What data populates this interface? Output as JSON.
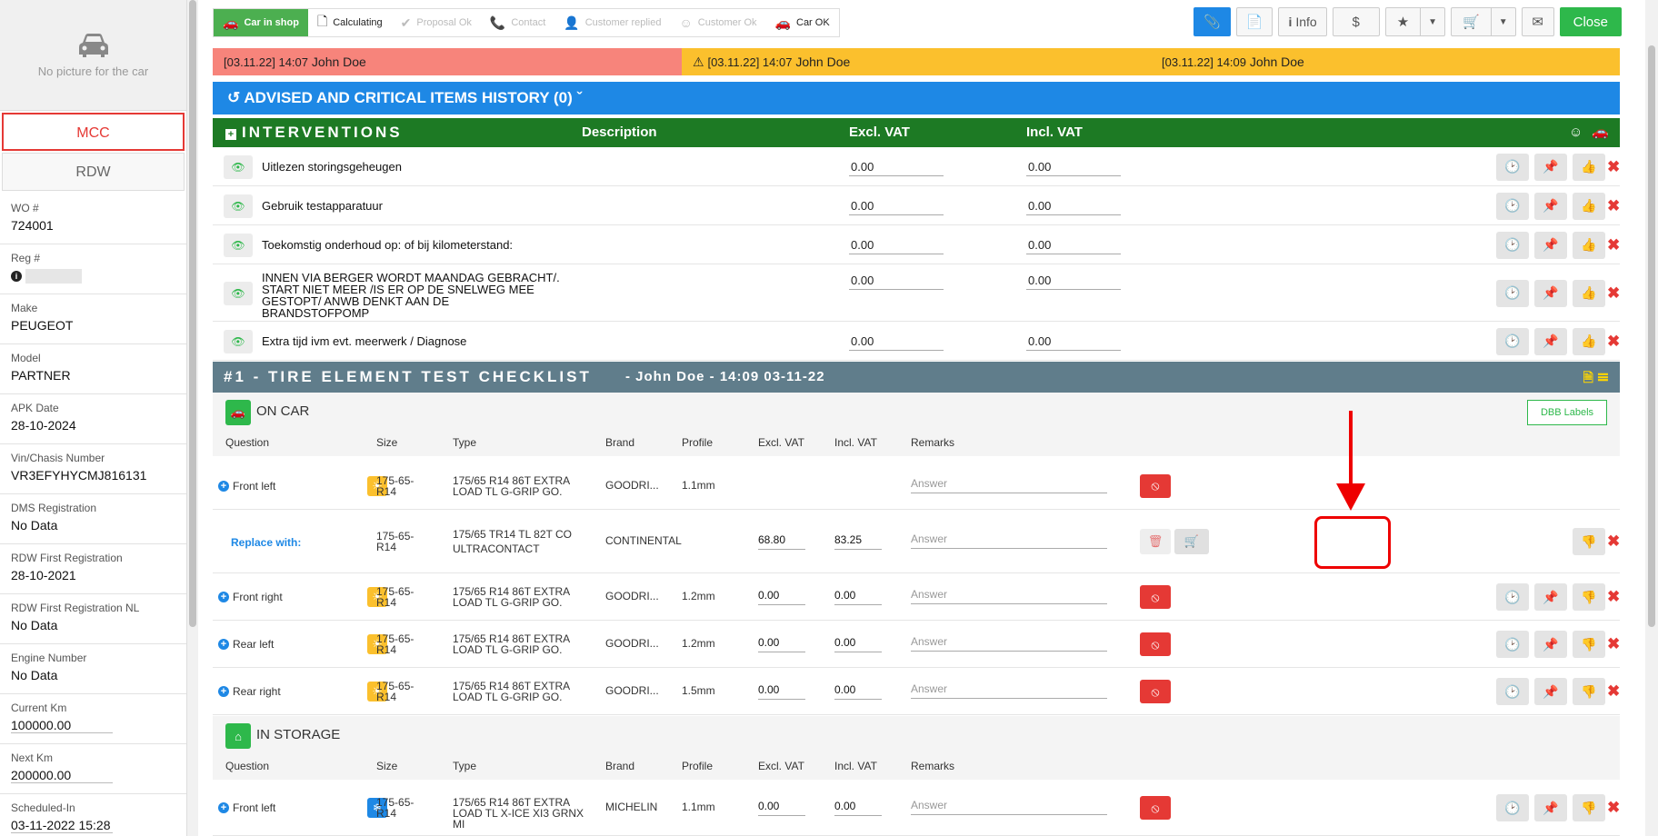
{
  "sidebar": {
    "no_picture": "No picture for the car",
    "mcc": "MCC",
    "rdw": "RDW",
    "fields": [
      {
        "label": "WO #",
        "value": "724001"
      },
      {
        "label": "Reg #",
        "value": ""
      },
      {
        "label": "Make",
        "value": "PEUGEOT"
      },
      {
        "label": "Model",
        "value": "PARTNER"
      },
      {
        "label": "APK Date",
        "value": "28-10-2024"
      },
      {
        "label": "Vin/Chasis Number",
        "value": "VR3EFYHYCMJ816131"
      },
      {
        "label": "DMS Registration",
        "value": "No Data"
      },
      {
        "label": "RDW First Registration",
        "value": "28-10-2021"
      },
      {
        "label": "RDW First Registration NL",
        "value": "No Data"
      },
      {
        "label": "Engine Number",
        "value": "No Data"
      },
      {
        "label": "Current Km",
        "value": "100000.00"
      },
      {
        "label": "Next Km",
        "value": "200000.00"
      },
      {
        "label": "Scheduled-In",
        "value": "03-11-2022 15:28"
      }
    ]
  },
  "steps": [
    {
      "label": "Car in shop",
      "icon": "car-icon"
    },
    {
      "label": "Calculating",
      "icon": "document-icon"
    },
    {
      "label": "Proposal Ok",
      "icon": "check-icon"
    },
    {
      "label": "Contact",
      "icon": "phone-icon"
    },
    {
      "label": "Customer replied",
      "icon": "user-check-icon"
    },
    {
      "label": "Customer Ok",
      "icon": "smile-icon"
    },
    {
      "label": "Car OK",
      "icon": "car-icon"
    }
  ],
  "toolbar": {
    "info": "Info",
    "dollar": "$",
    "close": "Close"
  },
  "notes": [
    {
      "date": "[03.11.22] 14:07",
      "name": "John Doe"
    },
    {
      "date": "[03.11.22] 14:07",
      "name": "John Doe"
    },
    {
      "date": "[03.11.22] 14:09",
      "name": "John Doe"
    }
  ],
  "history_title": "ADVISED AND CRITICAL ITEMS HISTORY (0)",
  "interventions": {
    "title": "INTERVENTIONS",
    "col_description": "Description",
    "col_excl": "Excl. VAT",
    "col_incl": "Incl. VAT",
    "rows": [
      {
        "text": "Uitlezen storingsgeheugen",
        "excl": "0.00",
        "incl": "0.00"
      },
      {
        "text": "Gebruik testapparatuur",
        "excl": "0.00",
        "incl": "0.00"
      },
      {
        "text": "Toekomstig onderhoud op: of bij kilometerstand:",
        "excl": "0.00",
        "incl": "0.00"
      },
      {
        "text": "INNEN VIA BERGER WORDT MAANDAG GEBRACHT/.\nSTART NIET MEER /IS ER OP DE SNELWEG MEE\nGESTOPT/ ANWB DENKT AAN DE\nBRANDSTOFPOMP",
        "excl": "0.00",
        "incl": "0.00"
      },
      {
        "text": "Extra tijd ivm evt. meerwerk / Diagnose",
        "excl": "0.00",
        "incl": "0.00"
      }
    ]
  },
  "checklist": {
    "title": "#1 - TIRE ELEMENT TEST CHECKLIST",
    "subtitle": "- John Doe - 14:09 03-11-22",
    "on_car": "ON CAR",
    "in_storage": "IN STORAGE",
    "dbb_labels": "DBB Labels",
    "columns": {
      "question": "Question",
      "size": "Size",
      "type": "Type",
      "brand": "Brand",
      "profile": "Profile",
      "excl": "Excl. VAT",
      "incl": "Incl. VAT",
      "remarks": "Remarks"
    },
    "answer_placeholder": "Answer",
    "replace_with": "Replace with:",
    "on_car_rows": [
      {
        "question": "Front left",
        "size": "175-65-\nR14",
        "type": "175/65 R14 86T EXTRA\nLOAD TL G-GRIP GO.",
        "brand": "GOODRI...",
        "profile": "1.1mm",
        "excl": "",
        "incl": ""
      },
      {
        "question": "",
        "size": "175-65-\nR14",
        "type": "175/65 TR14 TL 82T CO\nULTRACONTACT",
        "brand": "CONTINENTAL",
        "profile": "",
        "excl": "68.80",
        "incl": "83.25"
      },
      {
        "question": "Front right",
        "size": "175-65-\nR14",
        "type": "175/65 R14 86T EXTRA\nLOAD TL G-GRIP GO.",
        "brand": "GOODRI...",
        "profile": "1.2mm",
        "excl": "0.00",
        "incl": "0.00"
      },
      {
        "question": "Rear left",
        "size": "175-65-\nR14",
        "type": "175/65 R14 86T EXTRA\nLOAD TL G-GRIP GO.",
        "brand": "GOODRI...",
        "profile": "1.2mm",
        "excl": "0.00",
        "incl": "0.00"
      },
      {
        "question": "Rear right",
        "size": "175-65-\nR14",
        "type": "175/65 R14 86T EXTRA\nLOAD TL G-GRIP GO.",
        "brand": "GOODRI...",
        "profile": "1.5mm",
        "excl": "0.00",
        "incl": "0.00"
      }
    ],
    "storage_rows": [
      {
        "question": "Front left",
        "size": "175-65-\nR14",
        "type": "175/65 R14 86T EXTRA\nLOAD TL X-ICE XI3 GRNX\nMI",
        "brand": "MICHELIN",
        "profile": "1.1mm",
        "excl": "0.00",
        "incl": "0.00"
      }
    ]
  },
  "colors": {
    "green": "#2eb84b",
    "blue": "#1e88e5",
    "red": "#e53935",
    "yellow": "#fbc02d",
    "slate": "#607d8b",
    "dark_green": "#1d7a24"
  }
}
